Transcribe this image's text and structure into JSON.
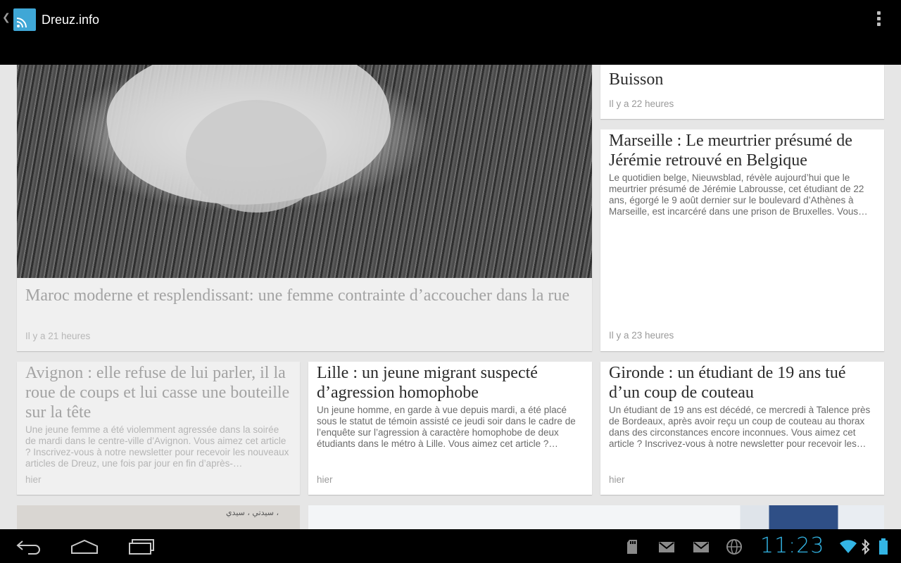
{
  "app": {
    "title": "Dreuz.info",
    "accent_color": "#33b5e5",
    "icon": "rss-feed-icon"
  },
  "articles": [
    {
      "id": "featured",
      "title": "Maroc moderne et resplendissant: une femme contrainte d’accoucher dans la rue",
      "time": "Il y a 21 heures",
      "read": true
    },
    {
      "id": "buisson",
      "title_partial": "à une chasse à l’homme contre Patrick Buisson",
      "time": "Il y a 22 heures",
      "read": false
    },
    {
      "id": "marseille",
      "title": "Marseille : Le meurtrier présumé de Jérémie retrouvé en Belgique",
      "snippet": "Le quotidien belge, Nieuwsblad, révèle aujourd’hui que le meurtrier présumé de Jérémie Labrousse, cet étudiant de 22 ans, égorgé le 9 août dernier sur le boulevard d’Athènes à Marseille, est incarcéré dans une prison de Bruxelles. Vous…",
      "time": "Il y a 23 heures",
      "read": false
    },
    {
      "id": "avignon",
      "title": "Avignon : elle refuse de lui parler, il la roue de coups et lui casse une bouteille sur la tête",
      "snippet": "Une jeune femme a été violemment agressée dans la soirée de mardi dans le centre-ville d’Avignon. Vous aimez cet article ? Inscrivez-vous à notre newsletter pour recevoir les nouveaux articles de Dreuz, une fois par jour en fin d’après-…",
      "time": "hier",
      "read": true
    },
    {
      "id": "lille",
      "title": "Lille : un jeune migrant suspecté d’agression homophobe",
      "snippet": "Un jeune homme, en garde à vue depuis mardi, a été placé sous le statut de témoin assisté ce jeudi soir dans le cadre de l’enquête sur l’agression à caractère homophobe de deux étudiants dans le métro à Lille. Vous aimez cet article ?…",
      "time": "hier",
      "read": false
    },
    {
      "id": "gironde",
      "title": "Gironde : un étudiant de 19 ans tué d’un coup de couteau",
      "snippet": "Un étudiant de 19 ans est décédé, ce mercredi à Talence près de Bordeaux, après avoir reçu un coup de couteau au thorax dans des circonstances encore inconnues. Vous aimez cet article ? Inscrivez-vous à notre newsletter pour recevoir les…",
      "time": "hier",
      "read": false
    }
  ],
  "thumb_text": "سيدتي ، سيدي ،",
  "statusbar": {
    "clock": "11:23",
    "icons": [
      "sd-card-icon",
      "gmail-icon",
      "email-icon",
      "vpn-globe-icon",
      "wifi-icon",
      "bluetooth-icon",
      "battery-icon"
    ]
  },
  "navbar": {
    "icons": [
      "back-icon",
      "home-icon",
      "recent-apps-icon"
    ]
  }
}
